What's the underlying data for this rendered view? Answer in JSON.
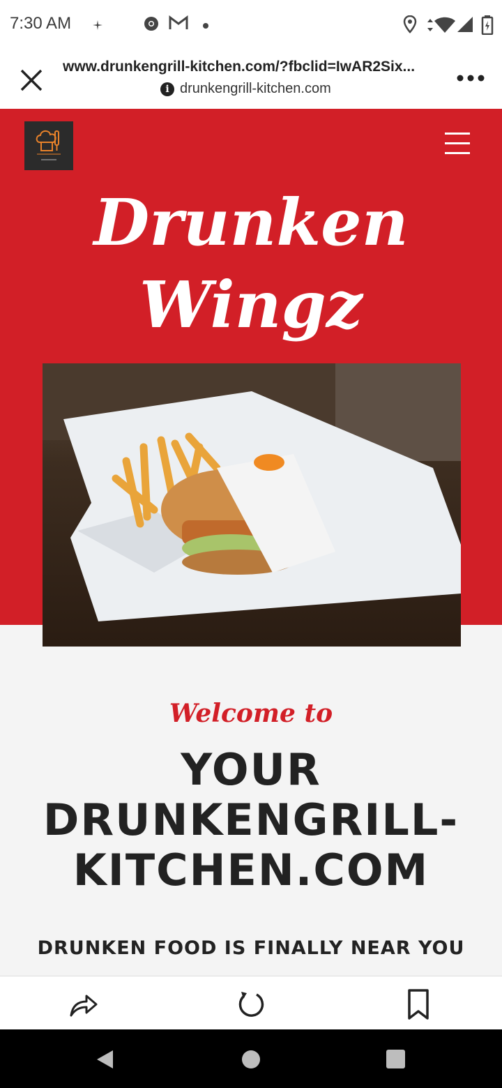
{
  "status_bar": {
    "time": "7:30 AM",
    "icons": [
      "sparkle-icon",
      "chrome-icon",
      "gmail-icon",
      "dot-icon",
      "location-icon",
      "data-arrows-icon",
      "wifi-icon",
      "signal-icon",
      "battery-icon"
    ]
  },
  "browser": {
    "url": "www.drunkengrill-kitchen.com/?fbclid=IwAR2Six...",
    "domain": "drunkengrill-kitchen.com",
    "icons": [
      "close-icon",
      "info-icon",
      "more-icon"
    ]
  },
  "hero": {
    "title_line1": "Drunken",
    "title_line2": "Wingz",
    "brand_color": "#d21f27",
    "image": "burger-and-fries-photo"
  },
  "content": {
    "welcome": "Welcome to",
    "heading_line1": "YOUR",
    "heading_line2": "DRUNKENGRILL-",
    "heading_line3": "KITCHEN.COM",
    "subheading": "DRUNKEN FOOD IS FINALLY NEAR YOU"
  },
  "toolbar": {
    "icons": [
      "share-icon",
      "refresh-icon",
      "bookmark-icon"
    ]
  },
  "nav": {
    "icons": [
      "back-icon",
      "home-icon",
      "recents-icon"
    ]
  }
}
